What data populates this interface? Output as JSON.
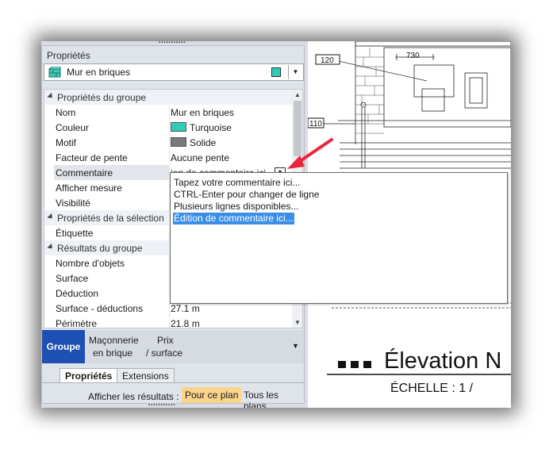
{
  "panel": {
    "title": "Propriétés",
    "selector": {
      "label": "Mur en briques",
      "swatch_color": "#2fcdb8"
    }
  },
  "grid": {
    "rows": [
      {
        "type": "group",
        "name": "Propriétés du groupe"
      },
      {
        "type": "prop",
        "name": "Nom",
        "value": "Mur en briques"
      },
      {
        "type": "prop",
        "name": "Couleur",
        "value": "Turquoise",
        "swatch": "#2fcdb8"
      },
      {
        "type": "prop",
        "name": "Motif",
        "value": "Solide",
        "swatch": "#7a7a7a"
      },
      {
        "type": "prop",
        "name": "Facteur de pente",
        "value": "Aucune pente"
      },
      {
        "type": "prop",
        "name": "Commentaire",
        "value": "ion de commentaire ici...",
        "selected": true
      },
      {
        "type": "prop",
        "name": "Afficher mesure",
        "value": ""
      },
      {
        "type": "prop",
        "name": "Visibilité",
        "value": ""
      },
      {
        "type": "group",
        "name": "Propriétés de la sélection"
      },
      {
        "type": "prop",
        "name": "Étiquette",
        "value": ""
      },
      {
        "type": "group",
        "name": "Résultats du groupe"
      },
      {
        "type": "prop",
        "name": "Nombre d'objets",
        "value": ""
      },
      {
        "type": "prop",
        "name": "Surface",
        "value": ""
      },
      {
        "type": "prop",
        "name": "Déduction",
        "value": ""
      },
      {
        "type": "prop",
        "name": "Surface - déductions",
        "value": "27.1 m"
      },
      {
        "type": "prop",
        "name": "Périmètre",
        "value": "21.8 m"
      }
    ]
  },
  "dropdown": {
    "items": [
      "Tapez votre commentaire ici...",
      "CTRL-Enter pour changer de ligne",
      "Plusieurs lignes disponibles...",
      "Édition de commentaire ici..."
    ],
    "highlighted_index": 3
  },
  "groupbar": {
    "groupe_label": "Groupe",
    "col1_line1": "Maçonnerie",
    "col1_line2": "en brique",
    "col2_line1": "Prix",
    "col2_line2": "/ surface"
  },
  "tabs": {
    "active": "Propriétés",
    "inactive": "Extensions"
  },
  "results": {
    "label": "Afficher les résultats :",
    "option_on": "Pour ce plan",
    "option_off": "Tous les plans"
  },
  "drawing": {
    "tag_120": "120",
    "tag_110": "110",
    "dim_730": "730",
    "elevation_title": "Élevation N",
    "scale_text": "ÉCHELLE  :  1 /"
  },
  "accent_color": "#1e4fb5",
  "highlight_color": "#fbd48c"
}
